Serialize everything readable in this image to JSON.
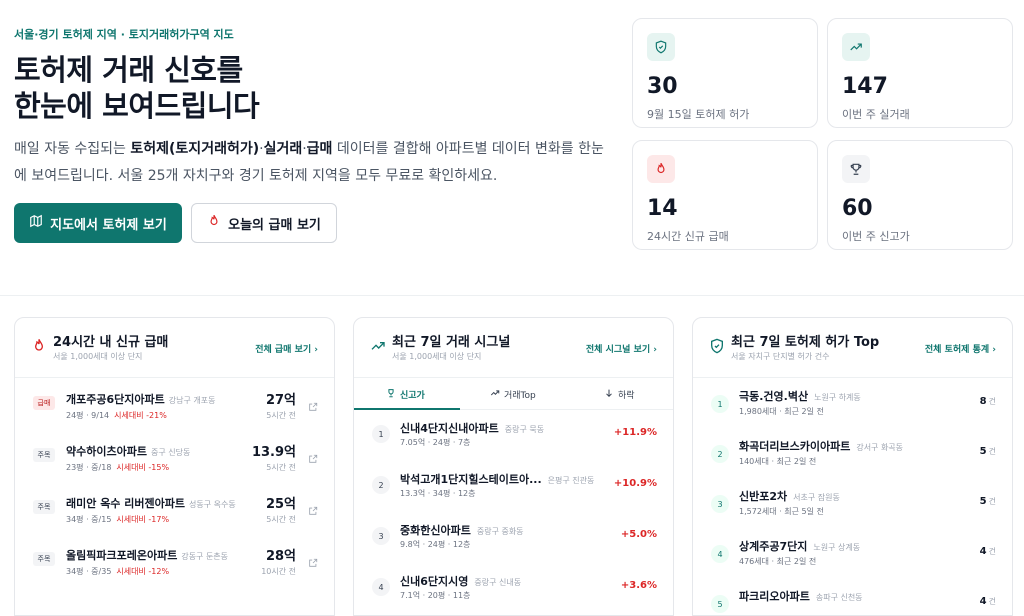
{
  "hero": {
    "eyebrow": "서울·경기 토허제 지역 · 토지거래허가구역 지도",
    "title_line1": "토허제 거래 신호를",
    "title_line2": "한눈에 보여드립니다",
    "desc_part1": "매일 자동 수집되는 ",
    "desc_bold1": "토허제(토지거래허가)",
    "desc_part2": "·",
    "desc_bold2": "실거래",
    "desc_part3": "·",
    "desc_bold3": "급매",
    "desc_part4": " 데이터를 결합해 아파트별 데이터 변화를 한눈에 보여드립니다. 서울 25개 자치구와 경기 토허제 지역을 모두 무료로 확인하세요.",
    "btn_map": "지도에서 토허제 보기",
    "btn_urgent": "오늘의 급매 보기"
  },
  "stats": [
    {
      "value": "30",
      "label": "9월 15일 토허제 허가",
      "icon": "shield-check-icon",
      "color": "#0f766e"
    },
    {
      "value": "147",
      "label": "이번 주 실거래",
      "icon": "trending-up-icon",
      "color": "#0f766e"
    },
    {
      "value": "14",
      "label": "24시간 신규 급매",
      "icon": "flame-icon",
      "color": "#dc2626"
    },
    {
      "value": "60",
      "label": "이번 주 신고가",
      "icon": "trophy-icon",
      "color": "#374151"
    }
  ],
  "urgent": {
    "title": "24시간 내 신규 급매",
    "subtitle": "서울 1,000세대 이상 단지",
    "link": "전체 급매 보기",
    "items": [
      {
        "badge": "급매",
        "name": "개포주공6단지아파트",
        "loc": "강남구 개포동",
        "meta": "24평 · 9/14",
        "diff": "시세대비 -21%",
        "price": "27억",
        "time": "5시간 전"
      },
      {
        "badge": "주목",
        "name": "약수하이츠아파트",
        "loc": "중구 신당동",
        "meta": "23평 · 중/18",
        "diff": "시세대비 -15%",
        "price": "13.9억",
        "time": "5시간 전"
      },
      {
        "badge": "주목",
        "name": "래미안 옥수 리버젠아파트",
        "loc": "성동구 옥수동",
        "meta": "34평 · 중/15",
        "diff": "시세대비 -17%",
        "price": "25억",
        "time": "5시간 전"
      },
      {
        "badge": "주목",
        "name": "올림픽파크포레온아파트",
        "loc": "강동구 둔촌동",
        "meta": "34평 · 중/35",
        "diff": "시세대비 -12%",
        "price": "28억",
        "time": "10시간 전"
      }
    ]
  },
  "signals": {
    "title": "최근 7일 거래 시그널",
    "subtitle": "서울 1,000세대 이상 단지",
    "link": "전체 시그널 보기",
    "tabs": [
      "신고가",
      "거래Top",
      "하락"
    ],
    "items": [
      {
        "rank": "1",
        "name": "신내4단지신내아파트",
        "loc": "중랑구 묵동",
        "meta": "7.05억 · 24평 · 7층",
        "pct": "+11.9%"
      },
      {
        "rank": "2",
        "name": "박석고개1단지힐스테이트아...",
        "loc": "은평구 진관동",
        "meta": "13.3억 · 34평 · 12층",
        "pct": "+10.9%"
      },
      {
        "rank": "3",
        "name": "중화한신아파트",
        "loc": "중랑구 중화동",
        "meta": "9.8억 · 24평 · 12층",
        "pct": "+5.0%"
      },
      {
        "rank": "4",
        "name": "신내6단지시영",
        "loc": "중랑구 신내동",
        "meta": "7.1억 · 20평 · 11층",
        "pct": "+3.6%"
      }
    ]
  },
  "permits": {
    "title": "최근 7일 토허제 허가 Top",
    "subtitle": "서울 자치구 단지별 허가 건수",
    "link": "전체 토허제 통계",
    "unit": "건",
    "items": [
      {
        "rank": "1",
        "name": "극동.건영.벽산",
        "loc": "노원구 하계동",
        "meta": "1,980세대 · 최근 2일 전",
        "count": "8"
      },
      {
        "rank": "2",
        "name": "화곡더리브스카이아파트",
        "loc": "강서구 화곡동",
        "meta": "140세대 · 최근 2일 전",
        "count": "5"
      },
      {
        "rank": "3",
        "name": "신반포2차",
        "loc": "서초구 잠원동",
        "meta": "1,572세대 · 최근 5일 전",
        "count": "5"
      },
      {
        "rank": "4",
        "name": "상계주공7단지",
        "loc": "노원구 상계동",
        "meta": "476세대 · 최근 2일 전",
        "count": "4"
      },
      {
        "rank": "5",
        "name": "파크리오아파트",
        "loc": "송파구 신천동",
        "meta": "",
        "count": "4"
      }
    ]
  }
}
